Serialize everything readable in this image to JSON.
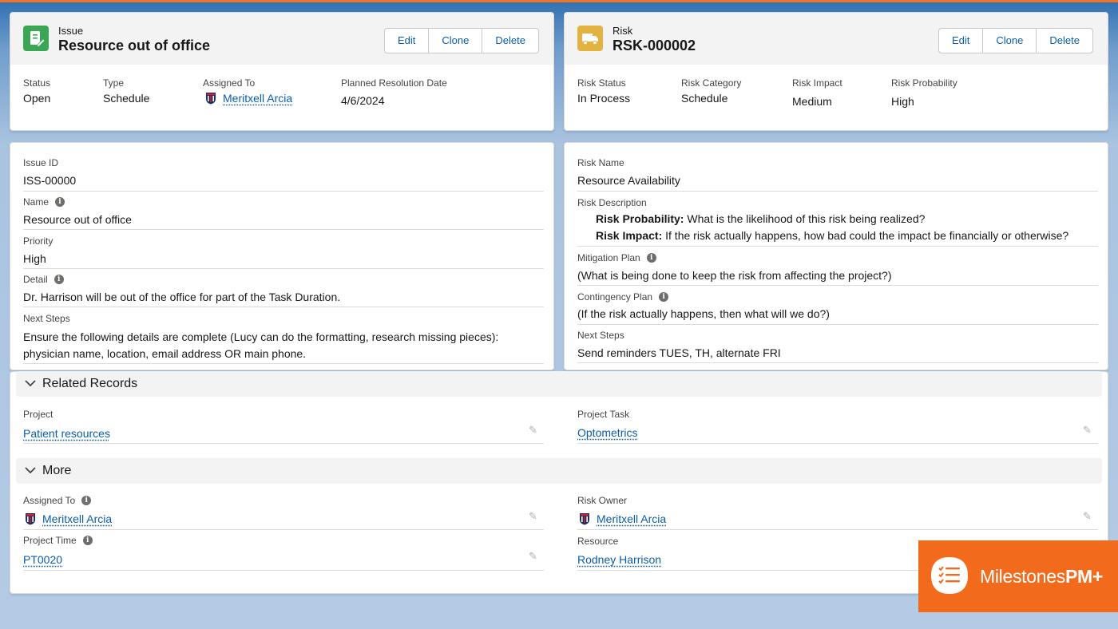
{
  "issue_header": {
    "type_label": "Issue",
    "title": "Resource out of office",
    "buttons": [
      "Edit",
      "Clone",
      "Delete"
    ],
    "fields": [
      {
        "label": "Status",
        "value": "Open"
      },
      {
        "label": "Type",
        "value": "Schedule"
      },
      {
        "label": "Assigned To",
        "value": "Meritxell Arcia"
      },
      {
        "label": "Planned Resolution Date",
        "value": "4/6/2024"
      }
    ]
  },
  "risk_header": {
    "type_label": "Risk",
    "title": "RSK-000002",
    "buttons": [
      "Edit",
      "Clone",
      "Delete"
    ],
    "fields": [
      {
        "label": "Risk Status",
        "value": "In Process"
      },
      {
        "label": "Risk Category",
        "value": "Schedule"
      },
      {
        "label": "Risk Impact",
        "value": "Medium"
      },
      {
        "label": "Risk Probability",
        "value": "High"
      }
    ]
  },
  "issue_details": {
    "issue_id": {
      "label": "Issue ID",
      "value": "ISS-00000"
    },
    "name": {
      "label": "Name",
      "value": "Resource out of office"
    },
    "priority": {
      "label": "Priority",
      "value": "High"
    },
    "detail": {
      "label": "Detail",
      "value": "Dr. Harrison will be out of the office for part of the Task Duration."
    },
    "next_steps": {
      "label": "Next Steps",
      "line1": "Ensure the following details are complete (Lucy can do the formatting, research missing pieces):",
      "line2": "physician name, location, email address OR main phone."
    }
  },
  "risk_details": {
    "risk_name": {
      "label": "Risk Name",
      "value": "Resource Availability"
    },
    "risk_description": {
      "label": "Risk Description",
      "probability_term": "Risk Probability:",
      "probability_text": " What is the likelihood of this risk being realized?",
      "impact_term": "Risk Impact:",
      "impact_text": " If the risk actually happens, how bad could the impact be financially or otherwise?"
    },
    "mitigation_plan": {
      "label": "Mitigation Plan",
      "value": "(What is being done to keep the risk from affecting the project?)"
    },
    "contingency_plan": {
      "label": "Contingency Plan",
      "value": "(If the risk actually happens, then what will we do?)"
    },
    "next_steps": {
      "label": "Next Steps",
      "value": "Send reminders TUES, TH, alternate FRI"
    }
  },
  "related_records": {
    "title": "Related Records",
    "project": {
      "label": "Project",
      "value": "Patient resources"
    },
    "project_task": {
      "label": "Project Task",
      "value": "Optometrics"
    }
  },
  "more": {
    "title": "More",
    "assigned_to": {
      "label": "Assigned To",
      "value": "Meritxell Arcia"
    },
    "risk_owner": {
      "label": "Risk Owner",
      "value": "Meritxell Arcia"
    },
    "project_time": {
      "label": "Project Time",
      "value": "PT0020"
    },
    "resource": {
      "label": "Resource",
      "value": "Rodney Harrison"
    }
  },
  "logo": {
    "text_regular": "Milestones",
    "text_bold": "PM+"
  },
  "colors": {
    "accent": "#f07423",
    "link": "#0b5cab",
    "issue_icon": "#3ba755",
    "risk_icon": "#e3b341",
    "logo_bg": "#f26b1d"
  },
  "icons": {
    "issue": "document-edit-icon",
    "risk": "truck-icon",
    "info": "info-icon",
    "edit": "pencil-icon",
    "section": "chevron-down-icon",
    "avatar": "crest-avatar-icon",
    "logo": "checklist-icon"
  }
}
